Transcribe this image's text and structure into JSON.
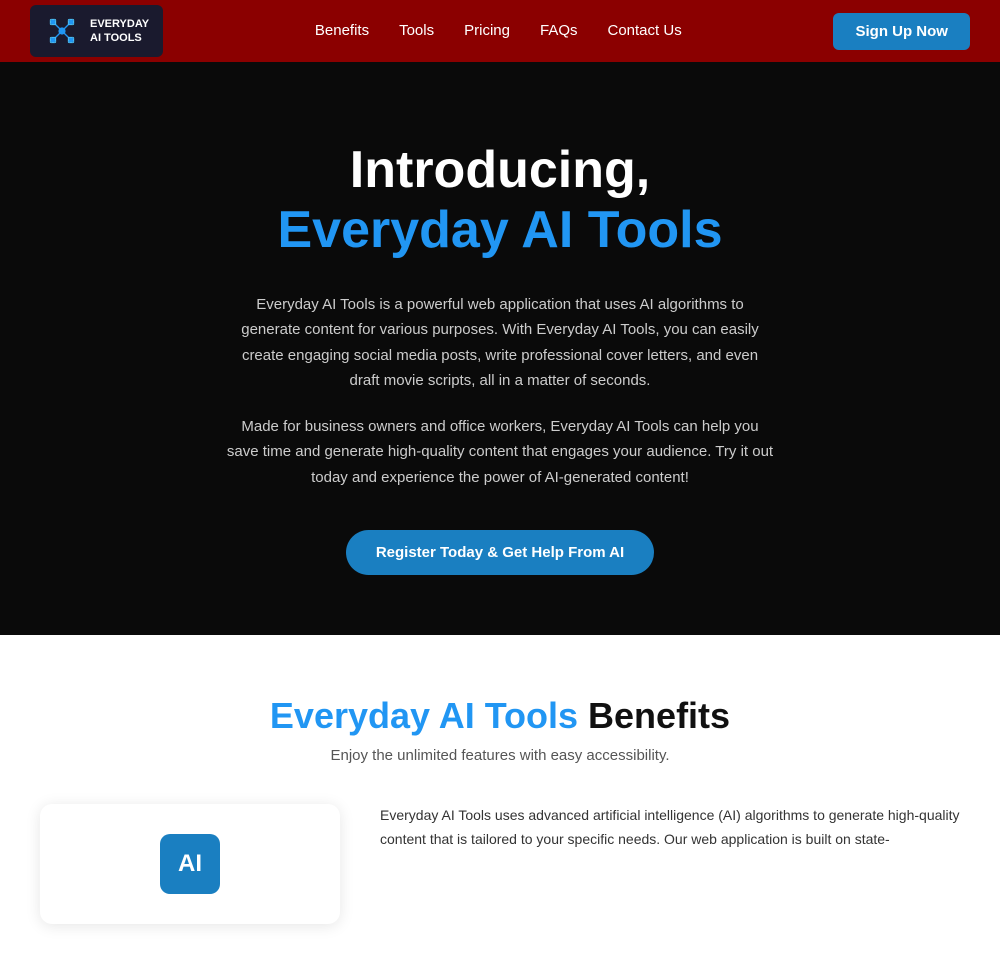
{
  "navbar": {
    "logo_line1": "EVERYDAY",
    "logo_line2": "AI TOOLS",
    "links": [
      {
        "label": "Benefits",
        "href": "#"
      },
      {
        "label": "Tools",
        "href": "#"
      },
      {
        "label": "Pricing",
        "href": "#"
      },
      {
        "label": "FAQs",
        "href": "#"
      },
      {
        "label": "Contact Us",
        "href": "#"
      }
    ],
    "cta_label": "Sign Up Now"
  },
  "hero": {
    "title_line1": "Introducing,",
    "title_line2": "Everyday AI Tools",
    "desc1": "Everyday AI Tools is a powerful web application that uses AI algorithms to generate content for various purposes. With Everyday AI Tools, you can easily create engaging social media posts, write professional cover letters, and even draft movie scripts, all in a matter of seconds.",
    "desc2": "Made for business owners and office workers, Everyday AI Tools can help you save time and generate high-quality content that engages your audience. Try it out today and experience the power of AI-generated content!",
    "cta_label": "Register Today & Get Help From AI"
  },
  "benefits": {
    "title_blue": "Everyday AI Tools",
    "title_black": " Benefits",
    "subtitle": "Enjoy the unlimited features with easy accessibility.",
    "ai_icon_label": "AI",
    "description": "Everyday AI Tools uses advanced artificial intelligence (AI) algorithms to generate high-quality content that is tailored to your specific needs. Our web application is built on state-"
  }
}
